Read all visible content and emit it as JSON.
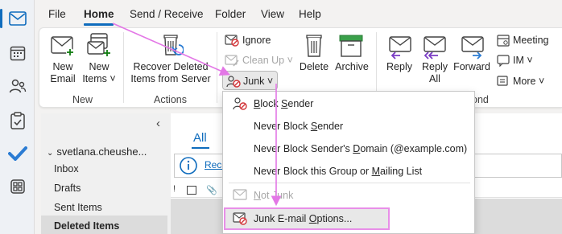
{
  "menubar": {
    "tabs": [
      "File",
      "Home",
      "Send / Receive",
      "Folder",
      "View",
      "Help"
    ],
    "active": "Home"
  },
  "ribbon": {
    "new_group": {
      "new_email": [
        "New",
        "Email"
      ],
      "new_items": [
        "New",
        "Items ˅"
      ],
      "label": "New"
    },
    "actions_group": {
      "recover": [
        "Recover Deleted",
        "Items from Server"
      ],
      "label": "Actions"
    },
    "delete_group": {
      "ignore": "Ignore",
      "clean_up": "Clean Up ˅",
      "junk": "Junk ˅",
      "delete": "Delete",
      "archive": "Archive"
    },
    "respond_group": {
      "reply": "Reply",
      "reply_all": [
        "Reply",
        "All"
      ],
      "forward": "Forward",
      "meeting": "Meeting",
      "im": "IM ˅",
      "more": "More ˅",
      "label_partial": "ond"
    }
  },
  "junk_menu": {
    "items": [
      {
        "text": "Block Sender",
        "underline": "S",
        "enabled": true
      },
      {
        "text": "Never Block Sender",
        "enabled": true
      },
      {
        "text": "Never Block Sender's Domain (@example.com)",
        "enabled": true
      },
      {
        "text": "Never Block this Group or Mailing List",
        "enabled": true
      },
      {
        "text": "Not Junk",
        "enabled": false
      },
      {
        "text": "Junk E-mail Options...",
        "enabled": true,
        "highlighted": true
      }
    ]
  },
  "nav": {
    "collapse_glyph": "‹",
    "account": "svetlana.cheushe...",
    "folders": [
      "Inbox",
      "Drafts",
      "Sent Items",
      "Deleted Items"
    ],
    "selected": "Deleted Items"
  },
  "list": {
    "filter_all": "All",
    "info_text": "Reco"
  },
  "colors": {
    "accent": "#0f6cbd",
    "highlight_box": "#e88fe8",
    "arrow": "#e377e6",
    "junk_red": "#d13438"
  },
  "icons": [
    "mail-icon",
    "calendar-icon",
    "people-icon",
    "tasks-icon",
    "todo-check-icon",
    "apps-icon",
    "ignore-icon",
    "clean-up-icon",
    "junk-icon",
    "delete-icon",
    "archive-icon",
    "reply-icon",
    "reply-all-icon",
    "forward-icon",
    "meeting-icon",
    "im-icon",
    "more-icon",
    "block-sender-icon",
    "not-junk-icon",
    "junk-options-icon",
    "info-icon"
  ]
}
